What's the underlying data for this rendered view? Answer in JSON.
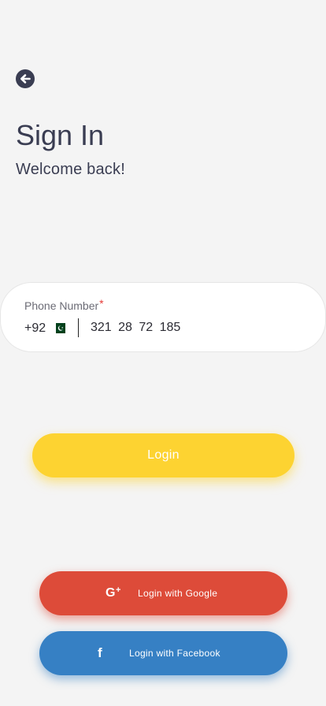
{
  "header": {
    "back_icon": "arrow-left-circle-icon",
    "title": "Sign In",
    "subtitle": "Welcome back!"
  },
  "phone": {
    "label": "Phone Number",
    "required_mark": "*",
    "dial_code": "+92",
    "flag_icon": "pakistan-flag-icon",
    "value": "321 28 72 185"
  },
  "actions": {
    "login_label": "Login",
    "login_color": "#fdd331",
    "google_label": "Login with Google",
    "google_icon": "google-plus-icon",
    "google_icon_text": "G",
    "google_icon_plus": "+",
    "google_color": "#dd4b39",
    "facebook_label": "Login with Facebook",
    "facebook_icon": "facebook-icon",
    "facebook_icon_text": "f",
    "facebook_color": "#3680c4"
  }
}
